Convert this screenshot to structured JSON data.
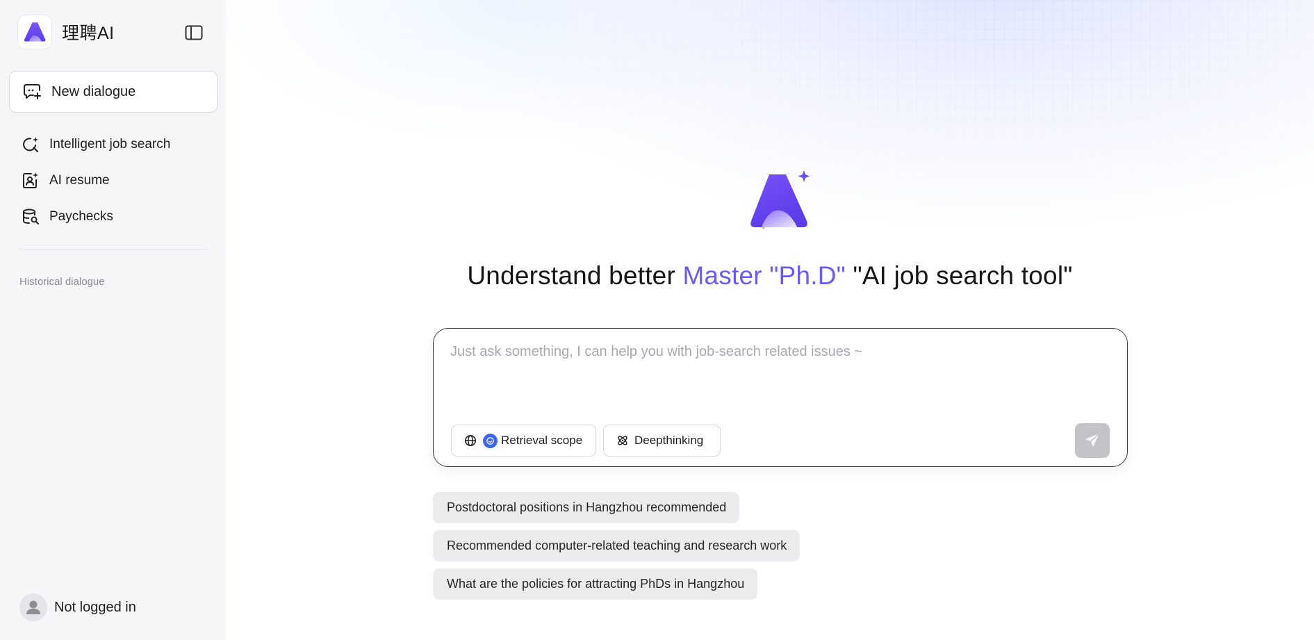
{
  "sidebar": {
    "brand_name": "理聘AI",
    "new_dialogue_label": "New dialogue",
    "nav_items": [
      {
        "label": "Intelligent job search",
        "icon": "search-sparkle-icon"
      },
      {
        "label": "AI resume",
        "icon": "resume-icon"
      },
      {
        "label": "Paychecks",
        "icon": "database-search-icon"
      }
    ],
    "history_label": "Historical dialogue",
    "user_label": "Not logged in"
  },
  "main": {
    "headline": {
      "part1": "Understand better",
      "accent": "Master \"Ph.D\"",
      "part2": "\"AI job search tool\""
    },
    "input": {
      "placeholder": "Just ask something, I can help you with job-search related issues ~",
      "value": ""
    },
    "tools": {
      "retrieval_label": "Retrieval scope",
      "deepthinking_label": "Deepthinking"
    },
    "suggestions": [
      "Postdoctoral positions in Hangzhou recommended",
      "Recommended computer-related teaching and research work",
      "What are the policies for attracting PhDs in Hangzhou"
    ]
  },
  "colors": {
    "accent": "#6a5cf0",
    "brand_purple": "#6b4df5",
    "sidebar_bg": "#f6f6f9",
    "scope_blue": "#3e66ec",
    "send_disabled": "#c4c4c8"
  }
}
